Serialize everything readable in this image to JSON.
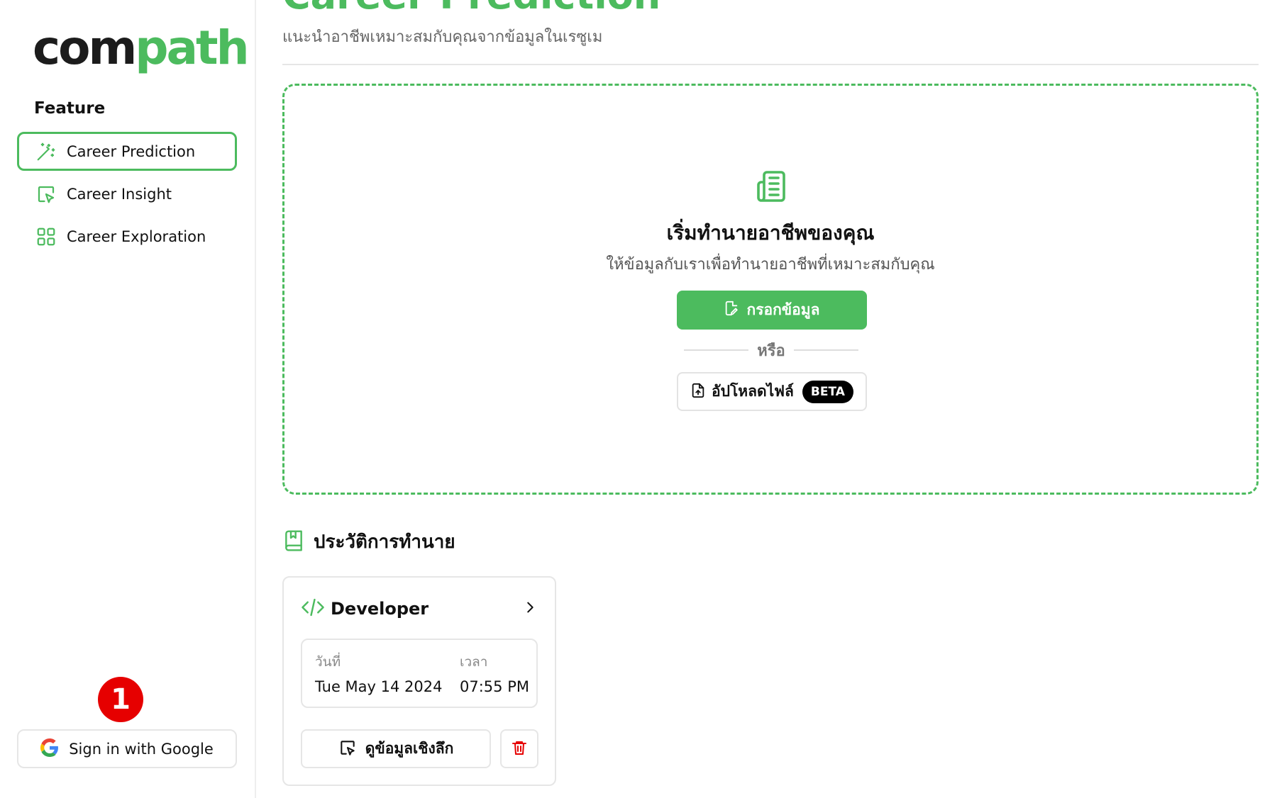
{
  "brand": {
    "logo_dark": "com",
    "logo_green": "path"
  },
  "sidebar": {
    "section_label": "Feature",
    "items": [
      {
        "label": "Career Prediction",
        "icon": "magic-wand-icon",
        "active": true
      },
      {
        "label": "Career Insight",
        "icon": "cursor-click-icon",
        "active": false
      },
      {
        "label": "Career Exploration",
        "icon": "grid-icon",
        "active": false
      }
    ],
    "badge_number": "1",
    "google_signin_label": "Sign in with Google"
  },
  "header": {
    "title": "Career Prediction",
    "subtitle": "แนะนำอาชีพเหมาะสมกับคุณจากข้อมูลในเรซูเม"
  },
  "start": {
    "icon": "newspaper-icon",
    "title": "เริ่มทำนายอาชีพของคุณ",
    "subtitle": "ให้ข้อมูลกับเราเพื่อทำนายอาชีพที่เหมาะสมกับคุณ",
    "fill_button_label": "กรอกข้อมูล",
    "or_label": "หรือ",
    "upload_button_label": "อัปโหลดไฟล์",
    "beta_label": "BETA"
  },
  "history": {
    "title": "ประวัติการทำนาย",
    "cards": [
      {
        "role": "Developer",
        "date_label": "วันที่",
        "date_value": "Tue May 14 2024",
        "time_label": "เวลา",
        "time_value": "07:55 PM",
        "deep_button_label": "ดูข้อมูลเชิงลึก"
      }
    ]
  },
  "colors": {
    "accent": "#4cbb5e",
    "danger": "#e60000",
    "text": "#111111"
  }
}
